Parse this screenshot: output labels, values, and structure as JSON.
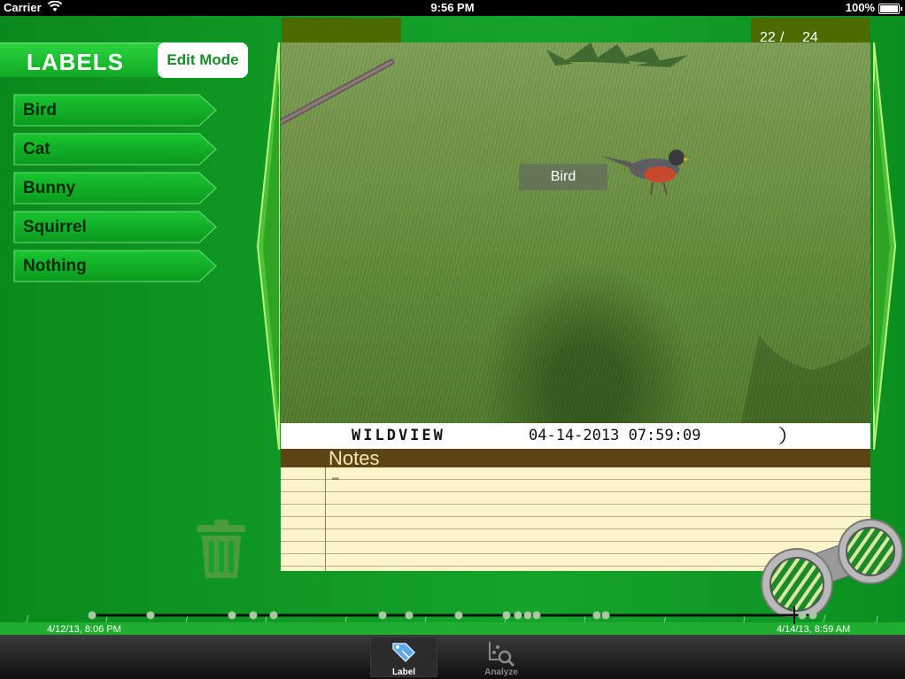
{
  "status_bar": {
    "carrier": "Carrier",
    "time": "9:56 PM",
    "battery": "100%"
  },
  "counter": {
    "current": "22",
    "separator": "/",
    "total": "24"
  },
  "labels": {
    "title": "LABELS",
    "edit_mode": "Edit Mode",
    "items": [
      "Bird",
      "Cat",
      "Bunny",
      "Squirrel",
      "Nothing"
    ]
  },
  "photo": {
    "tag": "Bird",
    "stamp_brand": "WILDVIEW",
    "stamp_datetime": "04-14-2013 07:59:09"
  },
  "notes": {
    "title": "Notes",
    "text": "\"\""
  },
  "timeline": {
    "start": "4/12/13, 8:06 PM",
    "end": "4/14/13, 8:59 AM"
  },
  "tabbar": {
    "tabs": [
      {
        "label": "Label",
        "active": true
      },
      {
        "label": "Analyze",
        "active": false
      }
    ]
  },
  "colors": {
    "accent_green": "#12a825",
    "notes_brown": "#5c4413",
    "tab_olive": "#4a6b00"
  }
}
